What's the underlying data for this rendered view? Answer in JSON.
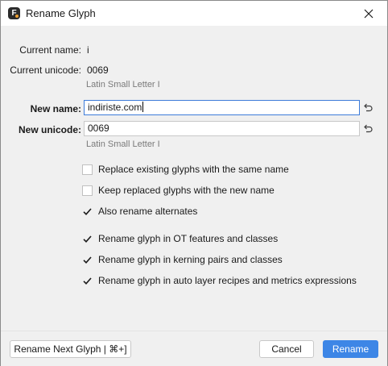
{
  "window": {
    "title": "Rename Glyph",
    "app_icon_letter": "F",
    "accent_color": "#3d86e6"
  },
  "current": {
    "name_label": "Current name:",
    "name_value": "i",
    "unicode_label": "Current unicode:",
    "unicode_value": "0069",
    "unicode_description": "Latin Small Letter I"
  },
  "new": {
    "name_label": "New name:",
    "name_value": "indiriste.com",
    "unicode_label": "New unicode:",
    "unicode_value": "0069",
    "unicode_description": "Latin Small Letter I"
  },
  "options": [
    {
      "label": "Replace existing glyphs with the same name",
      "checked": false
    },
    {
      "label": "Keep replaced glyphs with the new name",
      "checked": false
    },
    {
      "label": "Also rename alternates",
      "checked": true
    },
    {
      "label": "Rename glyph in OT features and classes",
      "checked": true
    },
    {
      "label": "Rename glyph in kerning pairs and classes",
      "checked": true
    },
    {
      "label": "Rename glyph in auto layer recipes and metrics expressions",
      "checked": true
    }
  ],
  "footer": {
    "next_label": "Rename Next Glyph | ⌘+]",
    "cancel_label": "Cancel",
    "rename_label": "Rename"
  },
  "icons": {
    "close": "close-icon",
    "revert": "revert-icon",
    "check": "checkmark-icon"
  }
}
